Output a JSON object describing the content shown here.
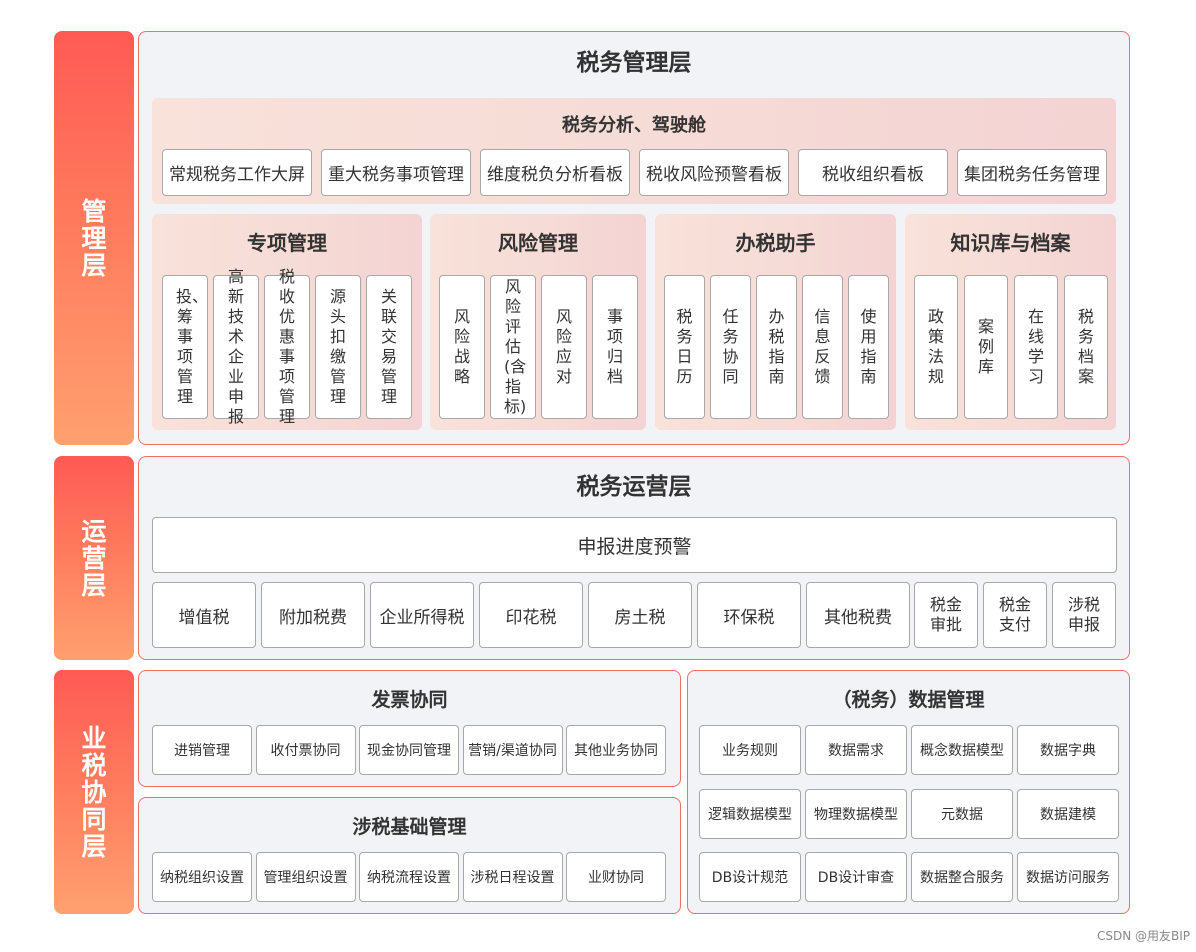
{
  "side_labels": {
    "management": "管理层",
    "operation": "运营层",
    "collaboration": "业税协同层"
  },
  "management": {
    "title": "税务管理层",
    "cockpit": {
      "title": "税务分析、驾驶舱",
      "items": [
        "常规税务工作大屏",
        "重大税务事项管理",
        "维度税负分析看板",
        "税收风险预警看板",
        "税收组织看板",
        "集团税务任务管理"
      ]
    },
    "special": {
      "title": "专项管理",
      "items": [
        "投、筹事项管理",
        "高新技术企业申报",
        "税收优惠事项管理",
        "源头扣缴管理",
        "关联交易管理"
      ]
    },
    "risk": {
      "title": "风险管理",
      "items": [
        "风险战略",
        "风险评估(含指标)",
        "风险应对",
        "事项归档"
      ]
    },
    "assistant": {
      "title": "办税助手",
      "items": [
        "税务日历",
        "任务协同",
        "办税指南",
        "信息反馈",
        "使用指南"
      ]
    },
    "knowledge": {
      "title": "知识库与档案",
      "items": [
        "政策法规",
        "案例库",
        "在线学习",
        "税务档案"
      ]
    }
  },
  "operation": {
    "title": "税务运营层",
    "banner": "申报进度预警",
    "taxes": [
      "增值税",
      "附加税费",
      "企业所得税",
      "印花税",
      "房土税",
      "环保税",
      "其他税费"
    ],
    "small": [
      "税金审批",
      "税金支付",
      "涉税申报"
    ]
  },
  "invoice": {
    "title": "发票协同",
    "items": [
      "进销管理",
      "收付票协同",
      "现金协同管理",
      "营销/渠道协同",
      "其他业务协同"
    ]
  },
  "base": {
    "title": "涉税基础管理",
    "items": [
      "纳税组织设置",
      "管理组织设置",
      "纳税流程设置",
      "涉税日程设置",
      "业财协同"
    ]
  },
  "datamgmt": {
    "title": "（税务）数据管理",
    "rows": [
      [
        "业务规则",
        "数据需求",
        "概念数据模型",
        "数据字典"
      ],
      [
        "逻辑数据模型",
        "物理数据模型",
        "元数据",
        "数据建模"
      ],
      [
        "DB设计规范",
        "DB设计审查",
        "数据整合服务",
        "数据访问服务"
      ]
    ]
  },
  "watermark": "CSDN @用友BIP"
}
